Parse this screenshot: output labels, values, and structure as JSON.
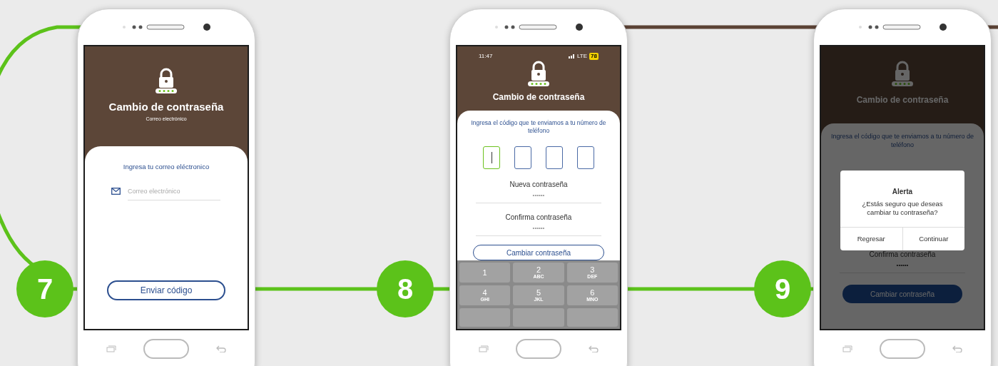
{
  "steps": [
    {
      "number": "7",
      "screen": {
        "kind": "email",
        "title": "Cambio de contraseña",
        "subtitle": "Correo electrónico",
        "instruction": "Ingresa tu correo eléctronico",
        "email_field": {
          "placeholder": "Correo electrónico"
        },
        "button": "Enviar código"
      }
    },
    {
      "number": "8",
      "screen": {
        "kind": "code",
        "status_bar": {
          "time": "11:47",
          "network": "LTE",
          "battery": "78"
        },
        "title": "Cambio de contraseña",
        "instruction": "Ingresa el código que te enviamos a tu número de teléfono",
        "code_boxes": [
          {
            "selected": true
          },
          {
            "selected": false
          },
          {
            "selected": false
          },
          {
            "selected": false
          }
        ],
        "new_password": {
          "label": "Nueva contraseña",
          "placeholder": "••••••"
        },
        "confirm_password": {
          "label": "Confirma contraseña",
          "placeholder": "••••••"
        },
        "button": "Cambiar contraseña",
        "keypad": [
          {
            "digit": "1"
          },
          {
            "digit": "2",
            "letters": "ABC"
          },
          {
            "digit": "3",
            "letters": "DEF"
          },
          {
            "digit": "4",
            "letters": "GHI"
          },
          {
            "digit": "5",
            "letters": "JKL"
          },
          {
            "digit": "6",
            "letters": "MNO"
          }
        ]
      }
    },
    {
      "number": "9",
      "screen": {
        "kind": "alert",
        "title": "Cambio de contraseña",
        "instruction": "Ingresa el código que te enviamos a tu número de teléfono",
        "confirm_password": {
          "label": "Confirma contraseña",
          "value": "••••••"
        },
        "button": "Cambiar contraseña",
        "dialog": {
          "title": "Alerta",
          "message": "¿Estás seguro que deseas cambiar tu contraseña?",
          "buttons": [
            "Regresar",
            "Continuar"
          ]
        }
      }
    }
  ]
}
